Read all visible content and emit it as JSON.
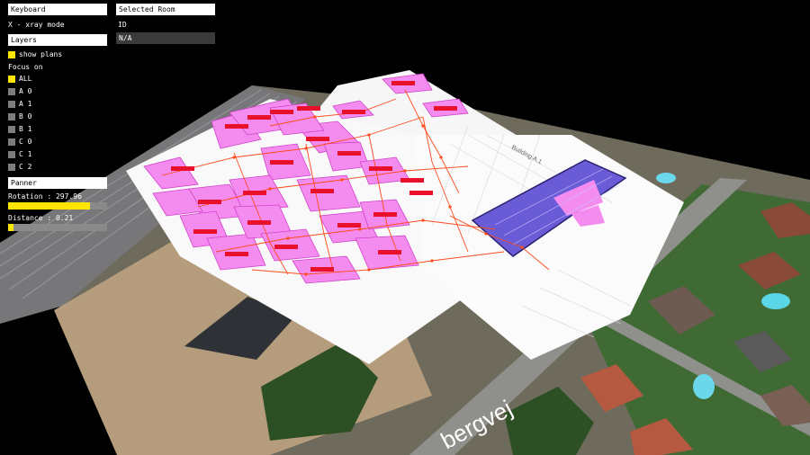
{
  "keyboard": {
    "header": "Keyboard",
    "xray_hint": "X - xray mode"
  },
  "layers": {
    "header": "Layers",
    "show_plans": {
      "label": "show plans",
      "checked": true
    }
  },
  "focus": {
    "title": "Focus on",
    "options": [
      {
        "label": "ALL",
        "checked": true
      },
      {
        "label": "A 0",
        "checked": false
      },
      {
        "label": "A 1",
        "checked": false
      },
      {
        "label": "B 0",
        "checked": false
      },
      {
        "label": "B 1",
        "checked": false
      },
      {
        "label": "C 0",
        "checked": false
      },
      {
        "label": "C 1",
        "checked": false
      },
      {
        "label": "C 2",
        "checked": false
      }
    ]
  },
  "panner": {
    "header": "Panner",
    "rotation": {
      "label": "Rotation : 297.96",
      "fraction": 0.83
    },
    "distance": {
      "label": "Distance : 0.21",
      "fraction": 0.05
    }
  },
  "selected_room": {
    "header": "Selected Room",
    "id_label": "ID",
    "id_value": "N/A"
  },
  "map": {
    "street_label": "bergvej",
    "building_label": "Building A.1",
    "colors": {
      "room_fill": "#f48cf0",
      "room_stroke": "#d040c8",
      "selected_room_fill": "#6a5cd6",
      "network_line": "#ff4a1a",
      "room_tag": "#e8102a",
      "plan_sheet": "#ffffff"
    }
  }
}
